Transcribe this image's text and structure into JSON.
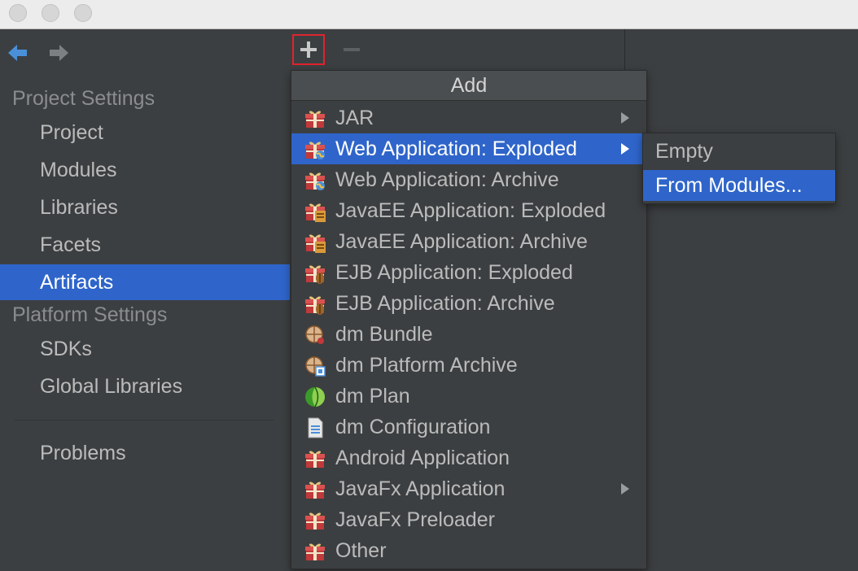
{
  "sidebar": {
    "sections": [
      {
        "label": "Project Settings"
      },
      {
        "label": "Platform Settings"
      }
    ],
    "items": [
      {
        "label": "Project"
      },
      {
        "label": "Modules"
      },
      {
        "label": "Libraries"
      },
      {
        "label": "Facets"
      },
      {
        "label": "Artifacts"
      },
      {
        "label": "SDKs"
      },
      {
        "label": "Global Libraries"
      },
      {
        "label": "Problems"
      }
    ],
    "selected": "Artifacts"
  },
  "menu": {
    "title": "Add",
    "items": [
      {
        "label": "JAR",
        "icon": "jar-icon",
        "has_submenu": true
      },
      {
        "label": "Web Application: Exploded",
        "icon": "web-app-icon",
        "has_submenu": true,
        "highlighted": true
      },
      {
        "label": "Web Application: Archive",
        "icon": "web-app-icon",
        "has_submenu": false
      },
      {
        "label": "JavaEE Application: Exploded",
        "icon": "javaee-icon",
        "has_submenu": false
      },
      {
        "label": "JavaEE Application: Archive",
        "icon": "javaee-icon",
        "has_submenu": false
      },
      {
        "label": "EJB Application: Exploded",
        "icon": "ejb-icon",
        "has_submenu": false
      },
      {
        "label": "EJB Application: Archive",
        "icon": "ejb-icon",
        "has_submenu": false
      },
      {
        "label": "dm Bundle",
        "icon": "bundle-icon",
        "has_submenu": false
      },
      {
        "label": "dm Platform Archive",
        "icon": "platform-archive-icon",
        "has_submenu": false
      },
      {
        "label": "dm Plan",
        "icon": "plan-icon",
        "has_submenu": false
      },
      {
        "label": "dm Configuration",
        "icon": "config-file-icon",
        "has_submenu": false
      },
      {
        "label": "Android Application",
        "icon": "gift-icon",
        "has_submenu": false
      },
      {
        "label": "JavaFx Application",
        "icon": "gift-icon",
        "has_submenu": true
      },
      {
        "label": "JavaFx Preloader",
        "icon": "gift-icon",
        "has_submenu": false
      },
      {
        "label": "Other",
        "icon": "gift-icon",
        "has_submenu": false
      }
    ]
  },
  "submenu": {
    "items": [
      {
        "label": "Empty"
      },
      {
        "label": "From Modules...",
        "highlighted": true
      }
    ]
  },
  "colors": {
    "background": "#3c3f41",
    "selection": "#2f65ca",
    "text": "#bbbbbb",
    "add_button_outline": "#e0232e"
  }
}
